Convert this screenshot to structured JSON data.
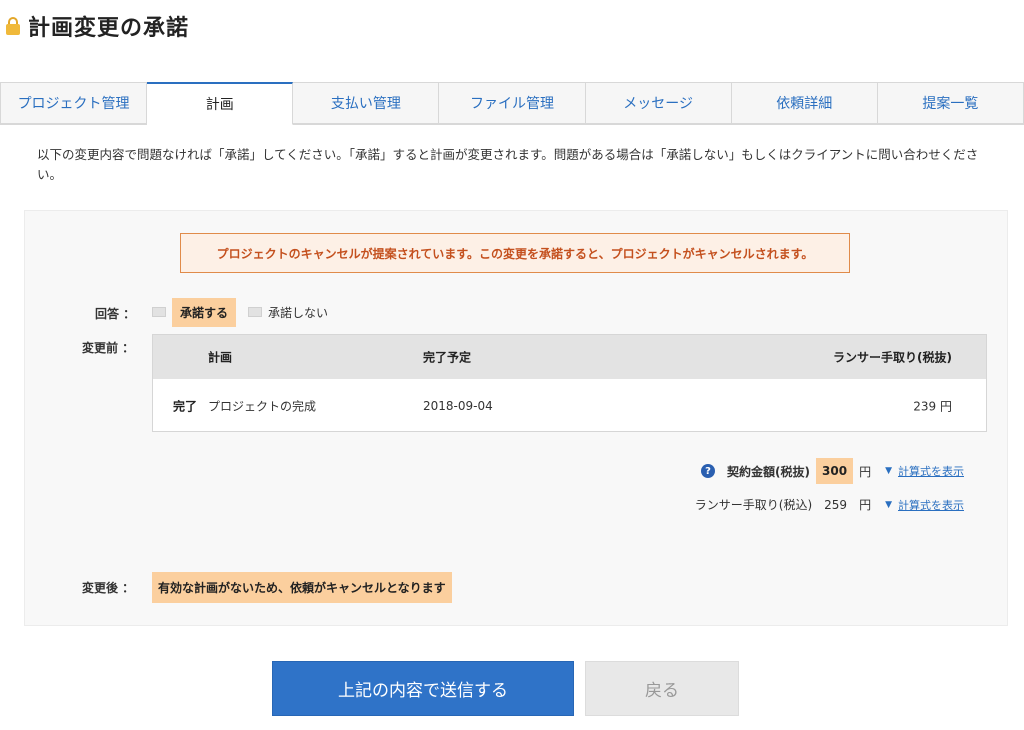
{
  "page_title": "計画変更の承諾",
  "tabs": [
    {
      "label": "プロジェクト管理"
    },
    {
      "label": "計画"
    },
    {
      "label": "支払い管理"
    },
    {
      "label": "ファイル管理"
    },
    {
      "label": "メッセージ"
    },
    {
      "label": "依頼詳細"
    },
    {
      "label": "提案一覧"
    }
  ],
  "intro_text": "以下の変更内容で問題なければ「承諾」してください。「承諾」すると計画が変更されます。問題がある場合は「承諾しない」もしくはクライアントに問い合わせください。",
  "alert_text": "プロジェクトのキャンセルが提案されています。この変更を承諾すると、プロジェクトがキャンセルされます。",
  "answer": {
    "label": "回答 ：",
    "option_accept": "承諾する",
    "option_reject": "承諾しない"
  },
  "before": {
    "label": "変更前 ：",
    "headers": {
      "plan": "計画",
      "due": "完了予定",
      "fee": "ランサー手取り(税抜)"
    },
    "row": {
      "status": "完了",
      "name": "プロジェクトの完成",
      "due": "2018-09-04",
      "fee": "239 円"
    }
  },
  "contract": {
    "label": "契約金額(税抜)",
    "amount": "300",
    "unit": "円",
    "link": "計算式を表示"
  },
  "lancer_fee": {
    "label": "ランサー手取り(税込)",
    "amount": "259",
    "unit": "円",
    "link": "計算式を表示"
  },
  "after": {
    "label": "変更後 ：",
    "note": "有効な計画がないため、依頼がキャンセルとなります"
  },
  "buttons": {
    "submit": "上記の内容で送信する",
    "back": "戻る"
  },
  "colors": {
    "accent": "#2f73c8",
    "highlight": "#fbcf9e",
    "alert_border": "#e08b4a"
  }
}
